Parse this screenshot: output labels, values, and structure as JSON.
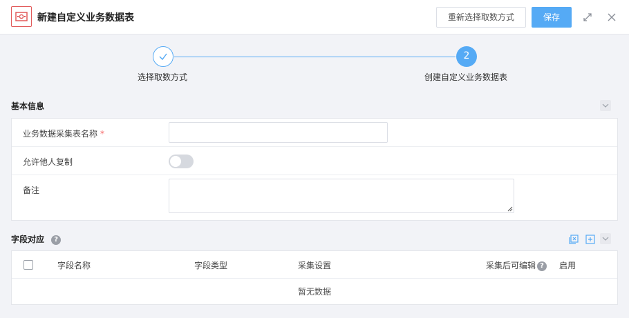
{
  "header": {
    "title": "新建自定义业务数据表",
    "reselect_label": "重新选择取数方式",
    "save_label": "保存"
  },
  "steps": [
    {
      "number": "",
      "label": "选择取数方式",
      "status": "done"
    },
    {
      "number": "2",
      "label": "创建自定义业务数据表",
      "status": "active"
    }
  ],
  "basic_info": {
    "title": "基本信息",
    "fields": [
      {
        "label": "业务数据采集表名称",
        "required_mark": "*",
        "value": ""
      },
      {
        "label": "允许他人复制",
        "value": "off"
      },
      {
        "label": "备注",
        "value": ""
      }
    ]
  },
  "field_mapping": {
    "title": "字段对应",
    "help": "?",
    "columns": [
      "字段名称",
      "字段类型",
      "采集设置",
      "采集后可编辑",
      "启用"
    ],
    "edit_help": "?",
    "rows": [],
    "empty_text": "暂无数据"
  },
  "colors": {
    "accent": "#55aaf5",
    "required": "#f56c6c",
    "icon_red": "#e25a5a"
  }
}
